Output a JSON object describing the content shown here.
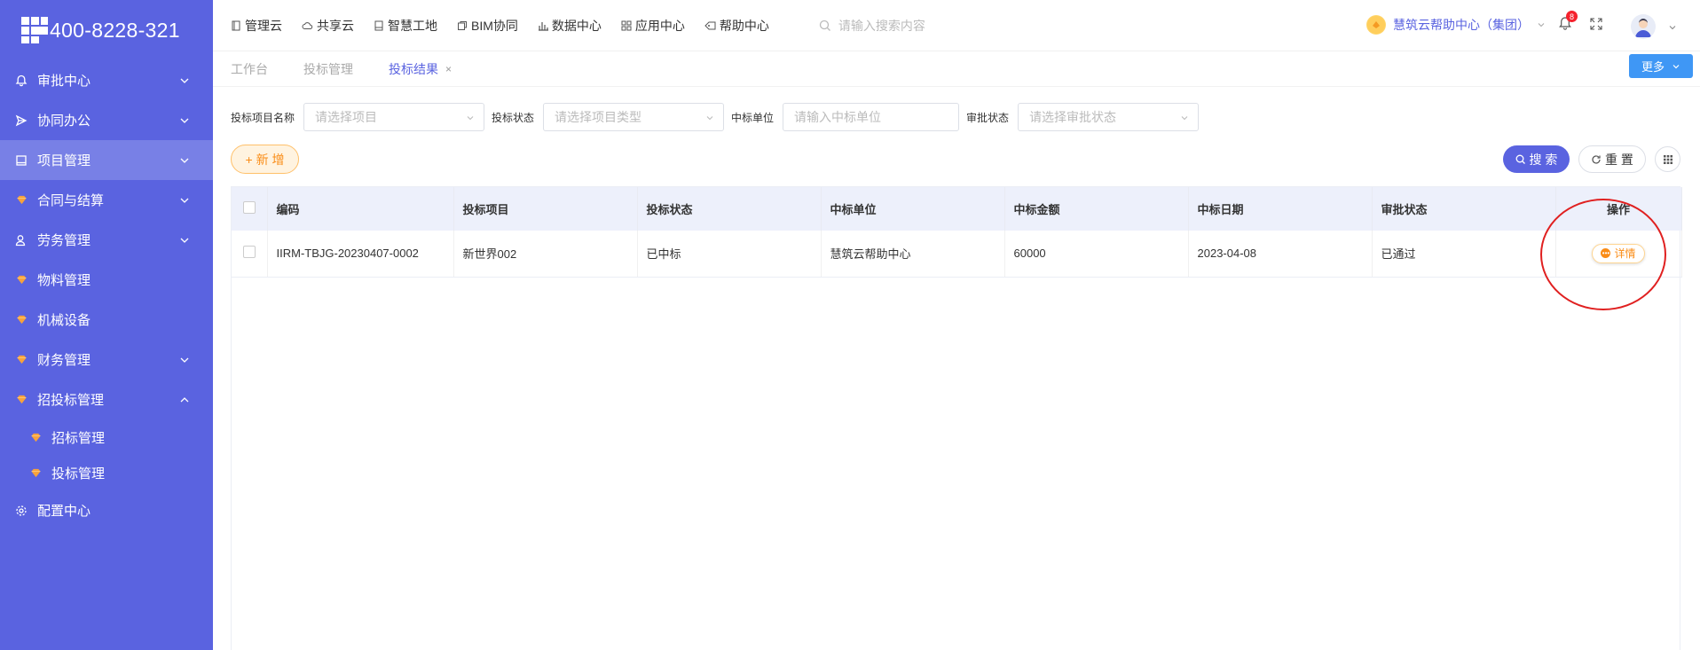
{
  "brand": {
    "phone": "400-8228-321"
  },
  "sidebar": {
    "items": [
      {
        "label": "审批中心",
        "icon": "bell-icon"
      },
      {
        "label": "协同办公",
        "icon": "send-icon"
      },
      {
        "label": "项目管理",
        "icon": "book-icon"
      },
      {
        "label": "合同与结算",
        "icon": "gem-icon"
      },
      {
        "label": "劳务管理",
        "icon": "user-icon"
      },
      {
        "label": "物料管理",
        "icon": "gem-icon"
      },
      {
        "label": "机械设备",
        "icon": "gem-icon"
      },
      {
        "label": "财务管理",
        "icon": "gem-icon"
      },
      {
        "label": "招投标管理",
        "icon": "gem-icon"
      },
      {
        "label": "招标管理",
        "icon": "gem-icon"
      },
      {
        "label": "投标管理",
        "icon": "gem-icon"
      },
      {
        "label": "配置中心",
        "icon": "gear-icon"
      }
    ]
  },
  "topnav": {
    "items": [
      {
        "label": "管理云",
        "icon": "doc-icon"
      },
      {
        "label": "共享云",
        "icon": "cloud-icon"
      },
      {
        "label": "智慧工地",
        "icon": "doc-icon"
      },
      {
        "label": "BIM协同",
        "icon": "copy-icon"
      },
      {
        "label": "数据中心",
        "icon": "chart-icon"
      },
      {
        "label": "应用中心",
        "icon": "apps-icon"
      },
      {
        "label": "帮助中心",
        "icon": "tag-icon"
      }
    ],
    "search_placeholder": "请输入搜索内容",
    "org_name": "慧筑云帮助中心（集团）",
    "notification_count": "8"
  },
  "tabs": [
    {
      "label": "工作台"
    },
    {
      "label": "投标管理"
    },
    {
      "label": "投标结果",
      "close": "×"
    }
  ],
  "more_button": "更多",
  "filters": {
    "project_name_label": "投标项目名称",
    "project_name_placeholder": "请选择项目",
    "bid_status_label": "投标状态",
    "bid_status_placeholder": "请选择项目类型",
    "winner_label": "中标单位",
    "winner_placeholder": "请输入中标单位",
    "approval_label": "审批状态",
    "approval_placeholder": "请选择审批状态"
  },
  "actions": {
    "add": "+ 新 增",
    "search": "搜 索",
    "reset": "重 置"
  },
  "table": {
    "headers": [
      "编码",
      "投标项目",
      "投标状态",
      "中标单位",
      "中标金额",
      "中标日期",
      "审批状态",
      "操作"
    ],
    "rows": [
      [
        "IIRM-TBJG-20230407-0002",
        "新世界002",
        "已中标",
        "慧筑云帮助中心",
        "60000",
        "2023-04-08",
        "已通过"
      ]
    ],
    "detail_label": "详情"
  },
  "colors": {
    "sidebar": "#5a63e0",
    "primary": "#5a63e0",
    "orange": "#fa8c16",
    "annotation": "#e02020"
  }
}
